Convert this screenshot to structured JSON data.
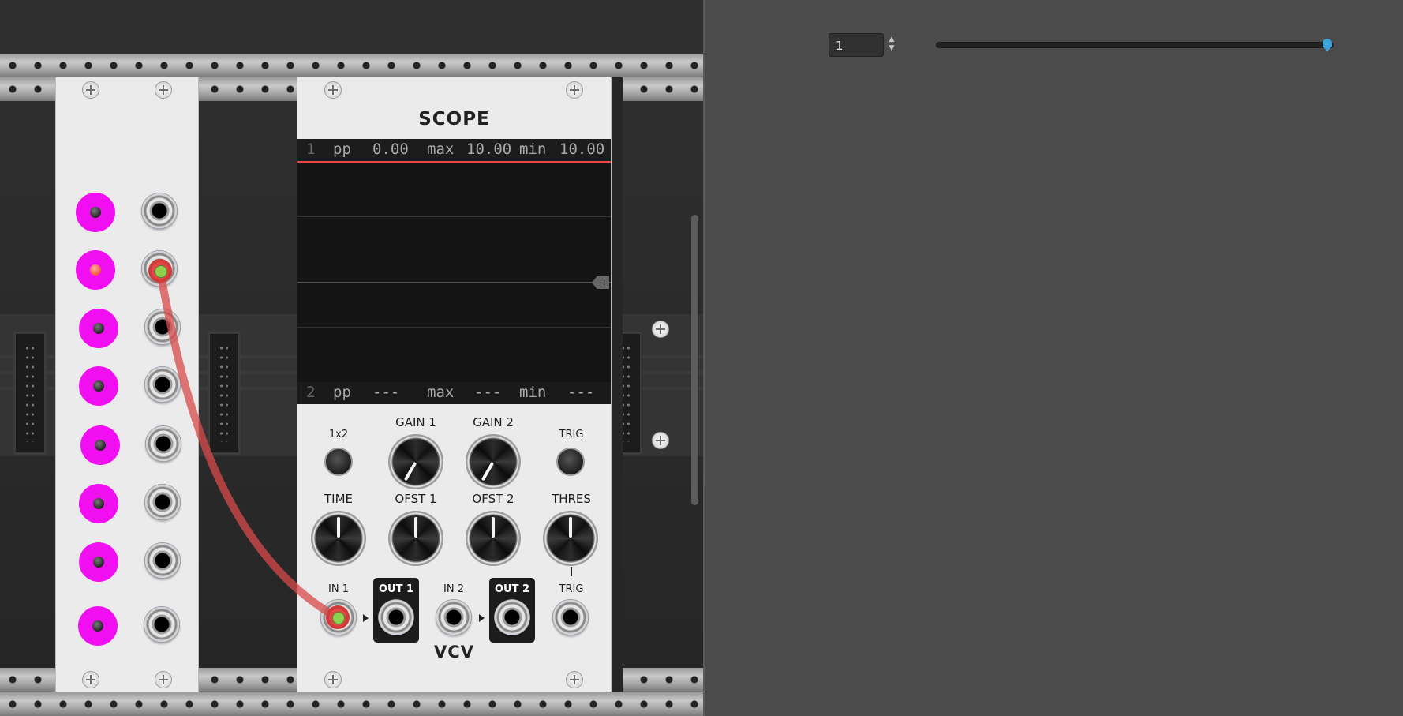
{
  "scope": {
    "title": "SCOPE",
    "ch1": {
      "num": "1",
      "pp_label": "pp",
      "pp": "0.00",
      "max_label": "max",
      "max": "10.00",
      "min_label": "min",
      "min": "10.00"
    },
    "ch2": {
      "num": "2",
      "pp_label": "pp",
      "pp": "---",
      "max_label": "max",
      "max": "---",
      "min_label": "min",
      "min": "---"
    },
    "trigger_marker": "T",
    "labels": {
      "x1x2": "1x2",
      "gain1": "GAIN 1",
      "gain2": "GAIN 2",
      "trig_btn": "TRIG",
      "time": "TIME",
      "ofst1": "OFST 1",
      "ofst2": "OFST 2",
      "thres": "THRES",
      "in1": "IN 1",
      "out1": "OUT 1",
      "in2": "IN 2",
      "out2": "OUT 2",
      "trig_in": "TRIG"
    },
    "logo": "VCV"
  },
  "right_pane": {
    "number_value": "1",
    "slider_value_fraction": 1.0
  },
  "colors": {
    "accent_pink": "#f10ff1",
    "cable_red": "#e14848",
    "plug_green": "#8fd14f",
    "slider_thumb": "#3da3d9"
  },
  "icons": [
    "screw-icon",
    "spin-arrows-icon",
    "trigger-marker-icon"
  ]
}
